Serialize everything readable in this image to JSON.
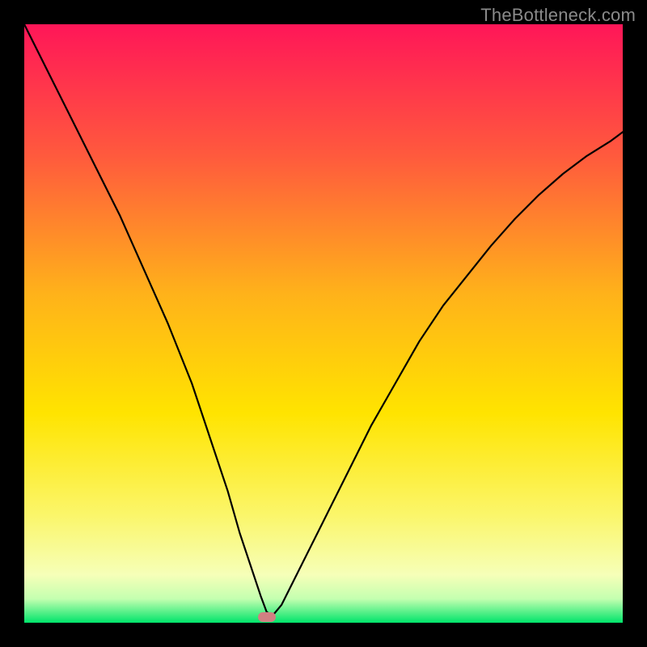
{
  "watermark": "TheBottleneck.com",
  "chart_data": {
    "type": "line",
    "title": "",
    "xlabel": "",
    "ylabel": "",
    "xlim": [
      0,
      100
    ],
    "ylim": [
      0,
      100
    ],
    "grid": false,
    "series": [
      {
        "name": "bottleneck-curve",
        "x": [
          0,
          4,
          8,
          12,
          16,
          20,
          24,
          28,
          31,
          34,
          36,
          38,
          39.5,
          40.5,
          41.5,
          43,
          46,
          50,
          54,
          58,
          62,
          66,
          70,
          74,
          78,
          82,
          86,
          90,
          94,
          98,
          100
        ],
        "y": [
          100,
          92,
          84,
          76,
          68,
          59,
          50,
          40,
          31,
          22,
          15,
          9,
          4.5,
          1.8,
          1.2,
          3,
          9,
          17,
          25,
          33,
          40,
          47,
          53,
          58,
          63,
          67.5,
          71.5,
          75,
          78,
          80.5,
          82
        ],
        "color": "#000000",
        "stroke_width": 2.2
      }
    ],
    "valley_marker": {
      "x": 40.5,
      "y": 1.0,
      "color": "#d18082"
    },
    "gradient": {
      "stops": [
        {
          "pct": 0,
          "color": "#ff1658"
        },
        {
          "pct": 22,
          "color": "#ff5a3d"
        },
        {
          "pct": 45,
          "color": "#ffb21a"
        },
        {
          "pct": 65,
          "color": "#ffe400"
        },
        {
          "pct": 82,
          "color": "#fbf66a"
        },
        {
          "pct": 92,
          "color": "#f6ffb8"
        },
        {
          "pct": 96,
          "color": "#c4ffb0"
        },
        {
          "pct": 100,
          "color": "#00e46a"
        }
      ]
    }
  }
}
